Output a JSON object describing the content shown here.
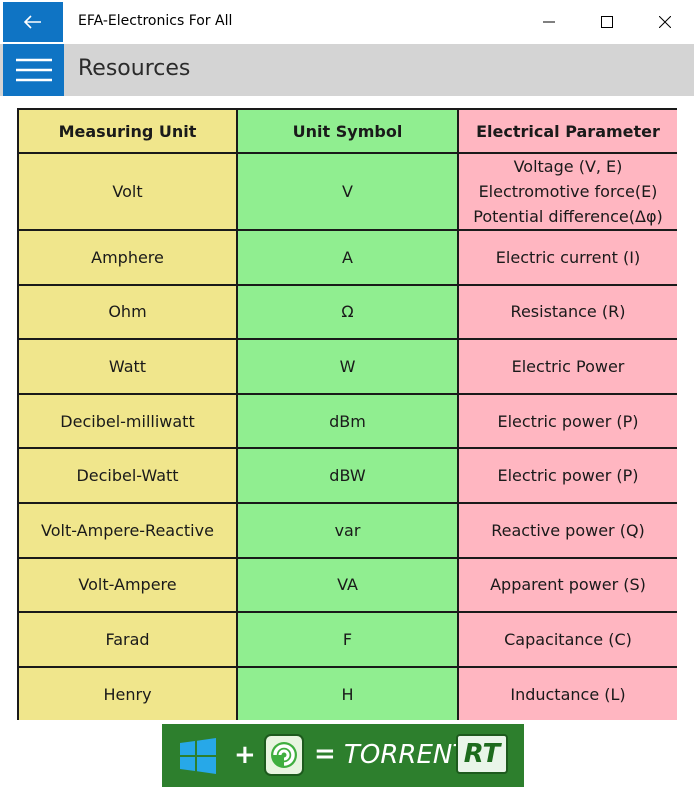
{
  "window": {
    "title": "EFA-Electronics For All"
  },
  "header": {
    "page_title": "Resources"
  },
  "table": {
    "headers": [
      "Measuring Unit",
      "Unit Symbol",
      "Electrical Parameter"
    ],
    "rows": [
      {
        "unit": "Volt",
        "symbol": "V",
        "param_lines": [
          "Voltage (V, E)",
          "Electromotive force(E)",
          "Potential difference(Δφ)"
        ]
      },
      {
        "unit": "Amphere",
        "symbol": "A",
        "param": "Electric current (I)"
      },
      {
        "unit": "Ohm",
        "symbol": "Ω",
        "param": "Resistance (R)"
      },
      {
        "unit": "Watt",
        "symbol": "W",
        "param": "Electric Power"
      },
      {
        "unit": "Decibel-milliwatt",
        "symbol": "dBm",
        "param": "Electric power (P)"
      },
      {
        "unit": "Decibel-Watt",
        "symbol": "dBW",
        "param": "Electric power (P)"
      },
      {
        "unit": "Volt-Ampere-Reactive",
        "symbol": "var",
        "param": "Reactive power (Q)"
      },
      {
        "unit": "Volt-Ampere",
        "symbol": "VA",
        "param": "Apparent power (S)"
      },
      {
        "unit": "Farad",
        "symbol": "F",
        "param": "Capacitance (C)"
      },
      {
        "unit": "Henry",
        "symbol": "H",
        "param": "Inductance (L)"
      }
    ]
  },
  "banner": {
    "plus": "+",
    "equals": "=",
    "brand": "TORRENT",
    "suffix": "RT"
  },
  "colors": {
    "accent": "#0f74c4",
    "header_bg": "#d4d4d4",
    "unit_col": "#f0e68c",
    "symbol_col": "#90ee90",
    "param_col": "#ffb6c1",
    "banner_bg": "#2d7f2d"
  },
  "icons": {
    "back": "back-arrow-icon",
    "menu": "hamburger-menu-icon",
    "minimize": "minimize-icon",
    "maximize": "maximize-icon",
    "close": "close-icon"
  }
}
